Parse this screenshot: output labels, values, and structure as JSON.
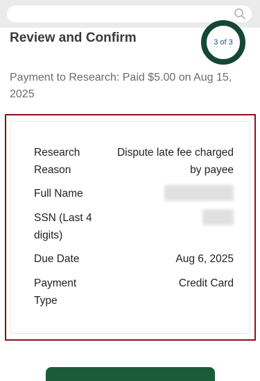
{
  "header": {
    "search_placeholder": ""
  },
  "page": {
    "title": "Review and Confirm",
    "step": "3 of 3"
  },
  "summary": "Payment to Research: Paid $5.00 on Aug 15, 2025",
  "details": {
    "research_reason": {
      "label": "Research Reason",
      "value": "Dispute late fee charged by payee"
    },
    "full_name": {
      "label": "Full Name",
      "value": ""
    },
    "ssn": {
      "label": "SSN (Last 4 digits)",
      "value": ""
    },
    "due_date": {
      "label": "Due Date",
      "value": "Aug 6, 2025"
    },
    "payment_type": {
      "label": "Payment Type",
      "value": "Credit Card"
    }
  },
  "colors": {
    "ring": "#154734",
    "highlight_border": "#8b0f16",
    "primary_button": "#1a5c38"
  }
}
